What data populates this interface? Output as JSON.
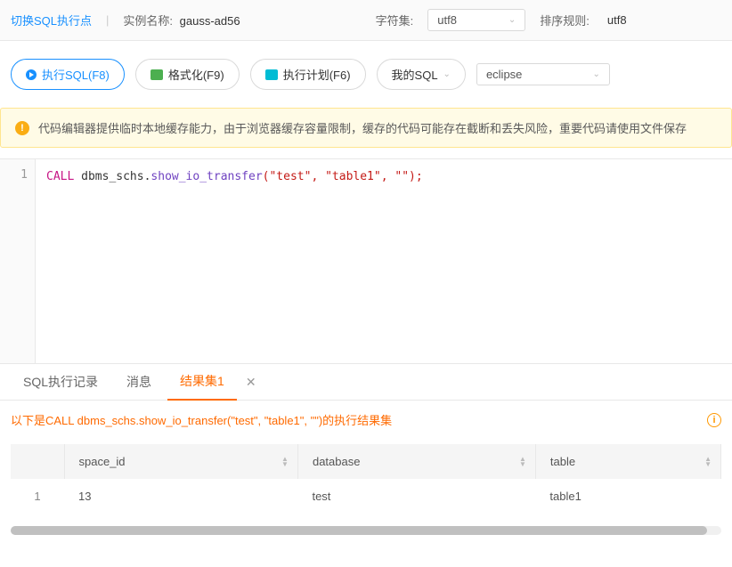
{
  "topbar": {
    "switch_link": "切换SQL执行点",
    "instance_label": "实例名称:",
    "instance_value": "gauss-ad56",
    "charset_label": "字符集:",
    "charset_value": "utf8",
    "collation_label": "排序规则:",
    "collation_value": "utf8"
  },
  "toolbar": {
    "execute": "执行SQL(F8)",
    "format": "格式化(F9)",
    "plan": "执行计划(F6)",
    "mysql": "我的SQL",
    "theme": "eclipse"
  },
  "warning": "代码编辑器提供临时本地缓存能力，由于浏览器缓存容量限制，缓存的代码可能存在截断和丢失风险，重要代码请使用文件保存",
  "editor": {
    "line": "1",
    "keyword": "CALL",
    "pkg": "dbms_schs.",
    "fn": "show_io_transfer",
    "args": "(\"test\", \"table1\", \"\");"
  },
  "tabs": {
    "history": "SQL执行记录",
    "message": "消息",
    "result": "结果集1"
  },
  "result": {
    "msg": "以下是CALL dbms_schs.show_io_transfer(\"test\", \"table1\", \"\")的执行结果集",
    "columns": [
      "space_id",
      "database",
      "table"
    ],
    "rows": [
      {
        "n": "1",
        "cells": [
          "13",
          "test",
          "table1"
        ]
      }
    ]
  }
}
